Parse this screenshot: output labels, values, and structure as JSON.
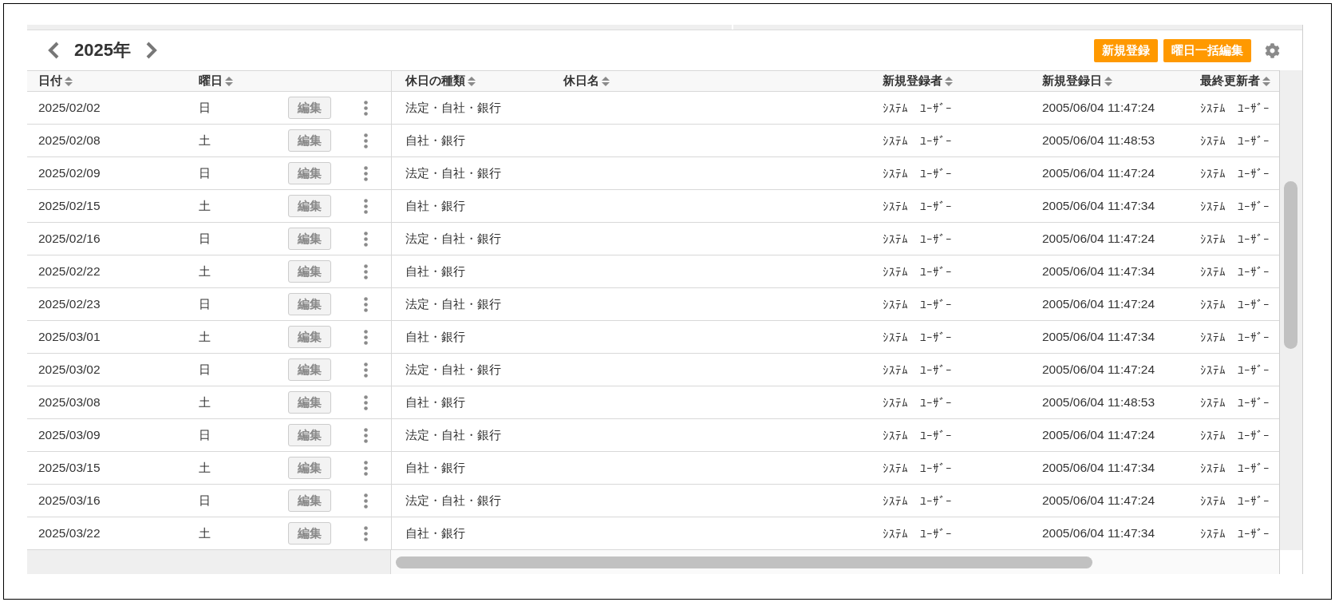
{
  "toolbar": {
    "year": "2025年",
    "buttons": [
      "新規登録",
      "曜日一括編集"
    ]
  },
  "table": {
    "columns": [
      "日付",
      "曜日",
      "休日の種類",
      "休日名",
      "新規登録者",
      "新規登録日",
      "最終更新者"
    ],
    "rows": [
      {
        "date": "2025/02/02",
        "weekday": "日",
        "edit_button": "編集",
        "holiday_type": "法定・自社・銀行",
        "created_by": "ｼｽﾃﾑ　ﾕｰｻﾞｰ",
        "created_at": "2005/06/04 11:47:24",
        "updated_by": "ｼｽﾃﾑ　ﾕｰｻﾞｰ"
      },
      {
        "date": "2025/02/08",
        "weekday": "土",
        "edit_button": "編集",
        "holiday_type": "自社・銀行",
        "created_by": "ｼｽﾃﾑ　ﾕｰｻﾞｰ",
        "created_at": "2005/06/04 11:48:53",
        "updated_by": "ｼｽﾃﾑ　ﾕｰｻﾞｰ"
      },
      {
        "date": "2025/02/09",
        "weekday": "日",
        "edit_button": "編集",
        "holiday_type": "法定・自社・銀行",
        "created_by": "ｼｽﾃﾑ　ﾕｰｻﾞｰ",
        "created_at": "2005/06/04 11:47:24",
        "updated_by": "ｼｽﾃﾑ　ﾕｰｻﾞｰ"
      },
      {
        "date": "2025/02/15",
        "weekday": "土",
        "edit_button": "編集",
        "holiday_type": "自社・銀行",
        "created_by": "ｼｽﾃﾑ　ﾕｰｻﾞｰ",
        "created_at": "2005/06/04 11:47:34",
        "updated_by": "ｼｽﾃﾑ　ﾕｰｻﾞｰ"
      },
      {
        "date": "2025/02/16",
        "weekday": "日",
        "edit_button": "編集",
        "holiday_type": "法定・自社・銀行",
        "created_by": "ｼｽﾃﾑ　ﾕｰｻﾞｰ",
        "created_at": "2005/06/04 11:47:24",
        "updated_by": "ｼｽﾃﾑ　ﾕｰｻﾞｰ"
      },
      {
        "date": "2025/02/22",
        "weekday": "土",
        "edit_button": "編集",
        "holiday_type": "自社・銀行",
        "created_by": "ｼｽﾃﾑ　ﾕｰｻﾞｰ",
        "created_at": "2005/06/04 11:47:34",
        "updated_by": "ｼｽﾃﾑ　ﾕｰｻﾞｰ"
      },
      {
        "date": "2025/02/23",
        "weekday": "日",
        "edit_button": "編集",
        "holiday_type": "法定・自社・銀行",
        "created_by": "ｼｽﾃﾑ　ﾕｰｻﾞｰ",
        "created_at": "2005/06/04 11:47:24",
        "updated_by": "ｼｽﾃﾑ　ﾕｰｻﾞｰ"
      },
      {
        "date": "2025/03/01",
        "weekday": "土",
        "edit_button": "編集",
        "holiday_type": "自社・銀行",
        "created_by": "ｼｽﾃﾑ　ﾕｰｻﾞｰ",
        "created_at": "2005/06/04 11:47:34",
        "updated_by": "ｼｽﾃﾑ　ﾕｰｻﾞｰ"
      },
      {
        "date": "2025/03/02",
        "weekday": "日",
        "edit_button": "編集",
        "holiday_type": "法定・自社・銀行",
        "created_by": "ｼｽﾃﾑ　ﾕｰｻﾞｰ",
        "created_at": "2005/06/04 11:47:24",
        "updated_by": "ｼｽﾃﾑ　ﾕｰｻﾞｰ"
      },
      {
        "date": "2025/03/08",
        "weekday": "土",
        "edit_button": "編集",
        "holiday_type": "自社・銀行",
        "created_by": "ｼｽﾃﾑ　ﾕｰｻﾞｰ",
        "created_at": "2005/06/04 11:48:53",
        "updated_by": "ｼｽﾃﾑ　ﾕｰｻﾞｰ"
      },
      {
        "date": "2025/03/09",
        "weekday": "日",
        "edit_button": "編集",
        "holiday_type": "法定・自社・銀行",
        "created_by": "ｼｽﾃﾑ　ﾕｰｻﾞｰ",
        "created_at": "2005/06/04 11:47:24",
        "updated_by": "ｼｽﾃﾑ　ﾕｰｻﾞｰ"
      },
      {
        "date": "2025/03/15",
        "weekday": "土",
        "edit_button": "編集",
        "holiday_type": "自社・銀行",
        "created_by": "ｼｽﾃﾑ　ﾕｰｻﾞｰ",
        "created_at": "2005/06/04 11:47:34",
        "updated_by": "ｼｽﾃﾑ　ﾕｰｻﾞｰ"
      },
      {
        "date": "2025/03/16",
        "weekday": "日",
        "edit_button": "編集",
        "holiday_type": "法定・自社・銀行",
        "created_by": "ｼｽﾃﾑ　ﾕｰｻﾞｰ",
        "created_at": "2005/06/04 11:47:24",
        "updated_by": "ｼｽﾃﾑ　ﾕｰｻﾞｰ"
      },
      {
        "date": "2025/03/22",
        "weekday": "土",
        "edit_button": "編集",
        "holiday_type": "自社・銀行",
        "created_by": "ｼｽﾃﾑ　ﾕｰｻﾞｰ",
        "created_at": "2005/06/04 11:47:34",
        "updated_by": "ｼｽﾃﾑ　ﾕｰｻﾞｰ"
      }
    ]
  }
}
